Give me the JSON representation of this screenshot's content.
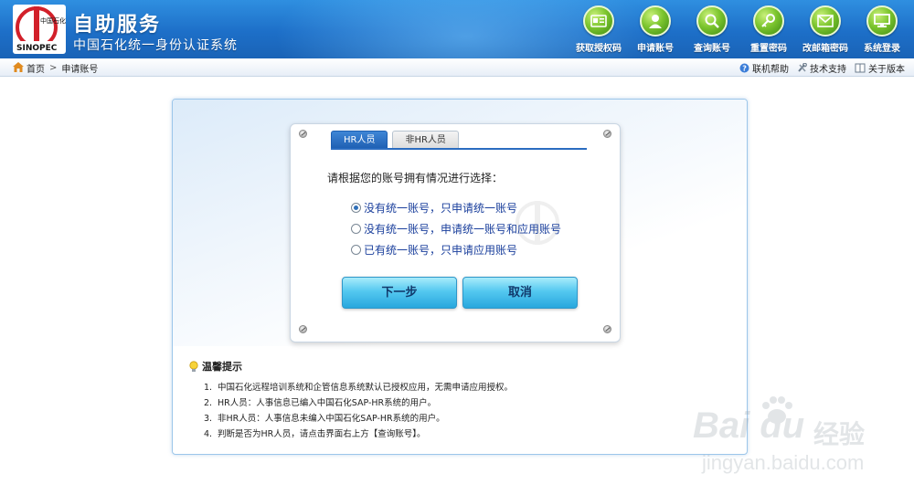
{
  "header": {
    "brand_logo_text": "SINOPEC 中国石化",
    "title": "自助服务",
    "subtitle": "中国石化统一身份认证系统",
    "nav": [
      {
        "label": "获取授权码",
        "icon": "id-card-icon"
      },
      {
        "label": "申请账号",
        "icon": "user-icon"
      },
      {
        "label": "查询账号",
        "icon": "search-icon"
      },
      {
        "label": "重置密码",
        "icon": "key-icon"
      },
      {
        "label": "改邮箱密码",
        "icon": "mail-icon"
      },
      {
        "label": "系统登录",
        "icon": "monitor-icon"
      }
    ]
  },
  "breadcrumb": {
    "home": "首页",
    "separator": ">",
    "current": "申请账号"
  },
  "toplinks": {
    "help": "联机帮助",
    "support": "技术支持",
    "about": "关于版本"
  },
  "dialog": {
    "tabs": [
      {
        "label": "HR人员",
        "active": true
      },
      {
        "label": "非HR人员",
        "active": false
      }
    ],
    "prompt": "请根据您的账号拥有情况进行选择：",
    "options": [
      {
        "label": "没有统一账号，只申请统一账号",
        "checked": true
      },
      {
        "label": "没有统一账号，申请统一账号和应用账号",
        "checked": false
      },
      {
        "label": "已有统一账号，只申请应用账号",
        "checked": false
      }
    ],
    "next_button": "下一步",
    "cancel_button": "取消"
  },
  "tips": {
    "title": "温馨提示",
    "items": [
      {
        "num": "1.",
        "text": "中国石化远程培训系统和企管信息系统默认已授权应用，无需申请应用授权。"
      },
      {
        "num": "2.",
        "text": "HR人员：人事信息已编入中国石化SAP-HR系统的用户。"
      },
      {
        "num": "3.",
        "text": "非HR人员：人事信息未编入中国石化SAP-HR系统的用户。"
      },
      {
        "num": "4.",
        "text": "判断是否为HR人员，请点击界面右上方【查询账号】。"
      }
    ]
  },
  "watermark": {
    "brand": "Bai du",
    "cn": "经验",
    "url": "jingyan.baidu.com"
  },
  "colors": {
    "header_blue": "#1d6fc8",
    "nav_icon_green": "#7cc52e",
    "tab_active": "#1e5fb2",
    "option_text": "#1a3f9c",
    "button_cyan": "#54c8f0"
  }
}
